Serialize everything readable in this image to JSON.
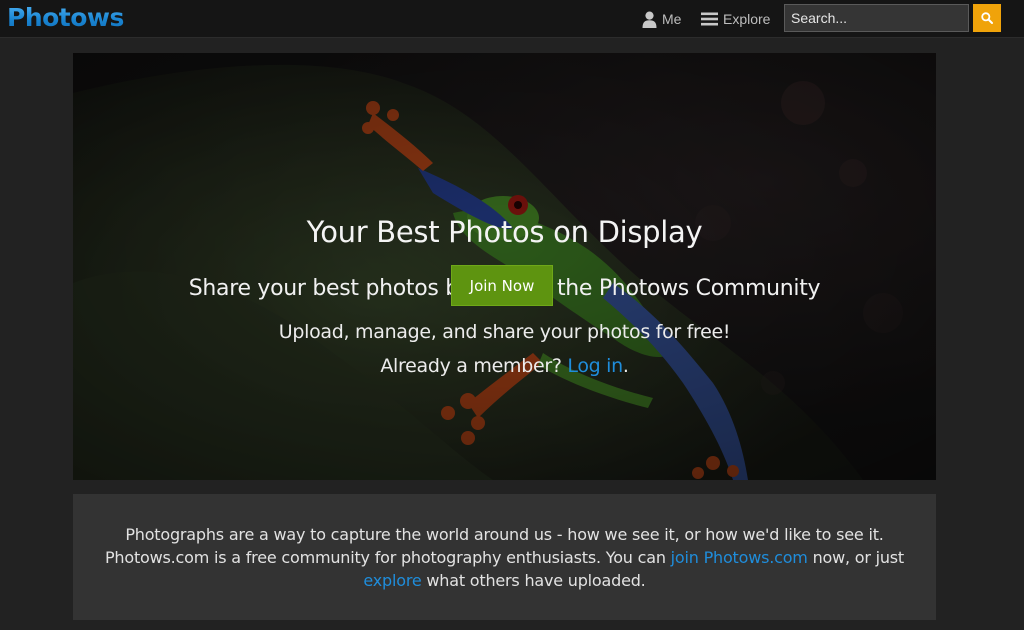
{
  "header": {
    "logo": "Photows",
    "nav": {
      "me_label": "Me",
      "explore_label": "Explore"
    },
    "search": {
      "placeholder": "Search...",
      "button_icon": "search-icon"
    }
  },
  "hero": {
    "title": "Your Best Photos on Display",
    "subtitle": "Share your best photos by Joining the Photows Community",
    "join_button": "Join Now",
    "upload_text": "Upload, manage, and share your photos for free!",
    "member_prefix": "Already a member? ",
    "login_link": "Log in",
    "member_suffix": "."
  },
  "info": {
    "part1": "Photographs are a way to capture the world around us - how we see it, or how we'd like to see it. Photows.com is a free community for photography enthusiasts. You can ",
    "join_link": "join Photows.com",
    "part2": " now, or just ",
    "explore_link": "explore",
    "part3": " what others have uploaded."
  },
  "colors": {
    "brand_blue": "#1d8bd6",
    "link_blue": "#1f8ddb",
    "join_green": "#5e9410",
    "search_orange": "#f0a30a",
    "background": "#222222",
    "info_bg": "#333333"
  }
}
